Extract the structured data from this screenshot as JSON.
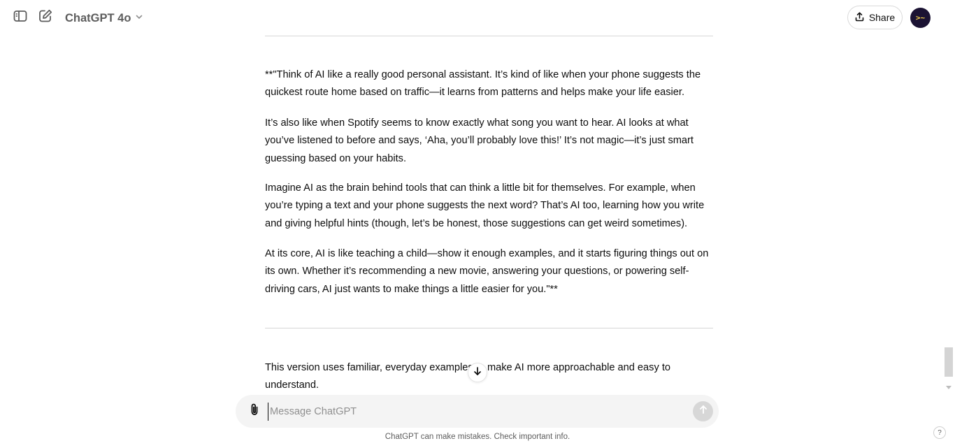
{
  "header": {
    "model_name": "ChatGPT 4o",
    "share_label": "Share",
    "avatar_text": ">~"
  },
  "conversation": {
    "paragraphs": [
      "**\"Think of AI like a really good personal assistant. It’s kind of like when your phone suggests the quickest route home based on traffic—it learns from patterns and helps make your life easier.",
      "It’s also like when Spotify seems to know exactly what song you want to hear. AI looks at what you’ve listened to before and says, ‘Aha, you’ll probably love this!’ It’s not magic—it’s just smart guessing based on your habits.",
      "Imagine AI as the brain behind tools that can think a little bit for themselves. For example, when you’re typing a text and your phone suggests the next word? That’s AI too, learning how you write and giving helpful hints (though, let’s be honest, those suggestions can get weird sometimes).",
      "At its core, AI is like teaching a child—show it enough examples, and it starts figuring things out on its own. Whether it’s recommending a new movie, answering your questions, or powering self-driving cars, AI just wants to make things a little easier for you.\"**",
      "This version uses familiar, everyday examples to make AI more approachable and easy to understand."
    ]
  },
  "composer": {
    "placeholder": "Message ChatGPT",
    "value": ""
  },
  "footer": {
    "disclaimer": "ChatGPT can make mistakes. Check important info.",
    "help_label": "?"
  },
  "icons": {
    "sidebar_toggle": "sidebar-icon",
    "new_chat": "edit-icon",
    "model_dropdown": "chevron-down-icon",
    "share": "upload-icon",
    "scroll_down": "arrow-down-icon",
    "attach": "paperclip-icon",
    "send": "arrow-up-icon"
  },
  "colors": {
    "avatar_bg": "#1b1333",
    "avatar_fg": "#f5d24a",
    "composer_bg": "#f4f4f4",
    "send_disabled": "#d7d7d7"
  }
}
